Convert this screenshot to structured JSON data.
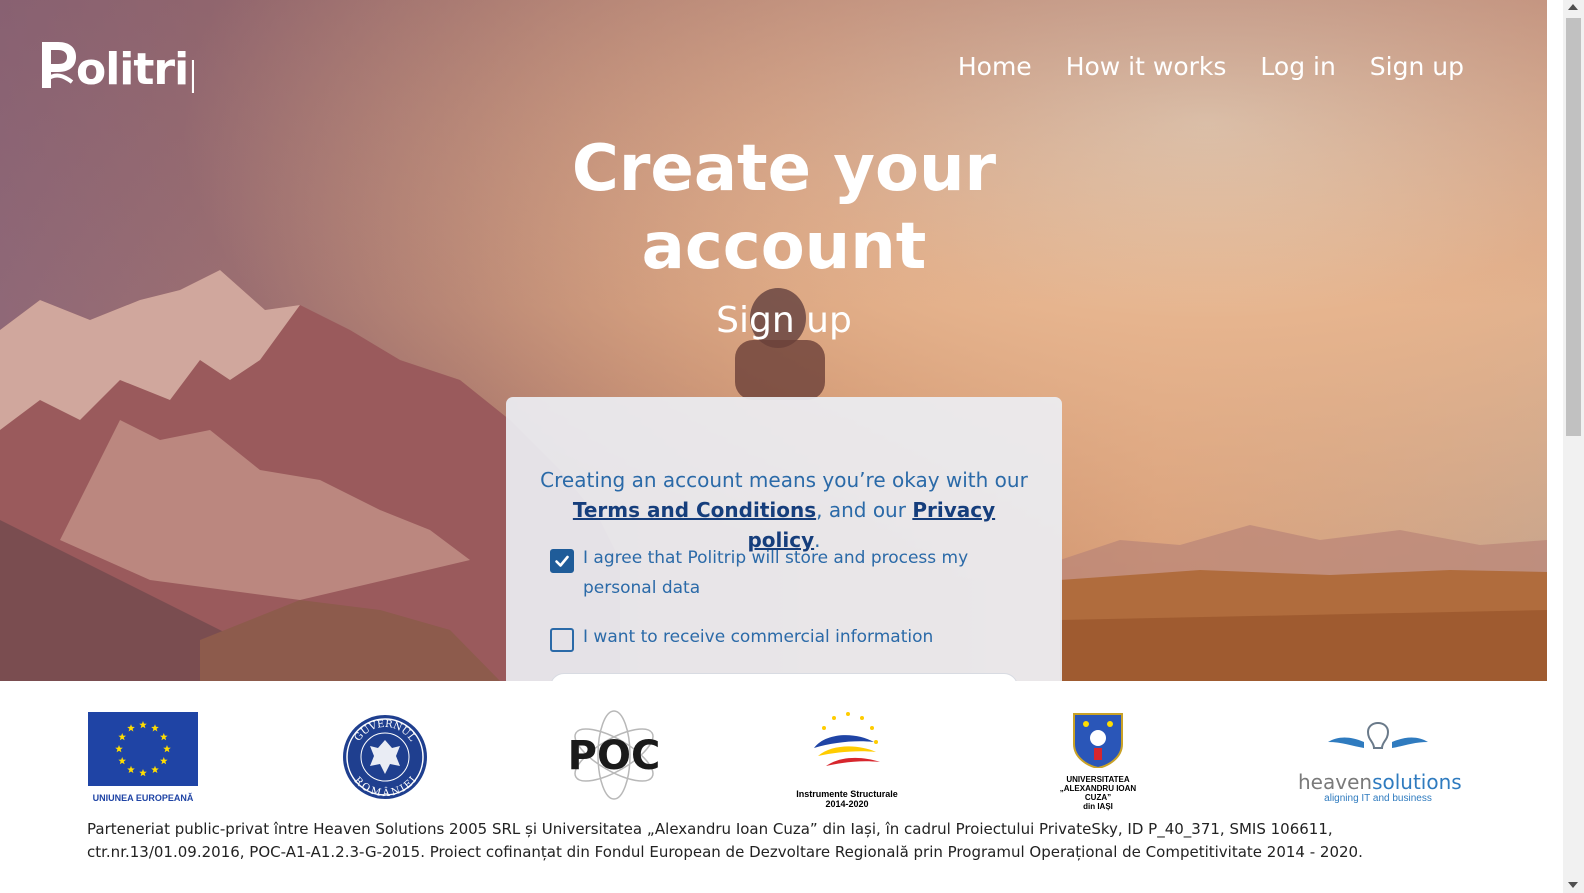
{
  "brand": {
    "name": "Politrip"
  },
  "nav": {
    "items": [
      "Home",
      "How it works",
      "Log in",
      "Sign up"
    ]
  },
  "hero": {
    "title_line1": "Create your",
    "title_line2": "account",
    "subtitle": "Sign up"
  },
  "card": {
    "notice_prefix": "Creating an account means you’re okay with our",
    "terms_link": "Terms and Conditions",
    "notice_middle": ", and our",
    "privacy_link": "Privacy policy",
    "notice_suffix": ".",
    "checkbox_store": {
      "label": "I agree that Politrip will store and process my personal data",
      "checked": true
    },
    "checkbox_commercial": {
      "label": "I want to receive commercial information",
      "checked": false
    }
  },
  "partners": {
    "eu_caption": "UNIUNEA EUROPEANĂ",
    "gov_text_top": "GUVERNUL",
    "gov_text_bottom": "ROMÂNIEI",
    "poc_text": "POC",
    "is_caption_line1": "Instrumente Structurale",
    "is_caption_line2": "2014-2020",
    "uaic_line1": "UNIVERSITATEA",
    "uaic_line2": "„ALEXANDRU IOAN CUZA”",
    "uaic_line3": "din IAȘI",
    "heaven_part1": "heaven",
    "heaven_part2": "solutions",
    "heaven_tagline": "aligning IT and business"
  },
  "footer": {
    "text": "Parteneriat public-privat între Heaven Solutions 2005 SRL și Universitatea „Alexandru Ioan Cuza” din Iași, în cadrul Proiectului PrivateSky, ID P_40_371, SMIS 106611, ctr.nr.13/01.09.2016, POC-A1-A1.2.3-G-2015. Proiect cofinanțat din Fondul European de Dezvoltare Regională prin Programul Operațional de Competitivitate 2014 - 2020."
  },
  "colors": {
    "accent": "#1f5c99",
    "link": "#163e7c",
    "notice_text": "#2b6aa8",
    "eu_blue": "#1f44a5",
    "eu_star": "#ffdd00"
  }
}
